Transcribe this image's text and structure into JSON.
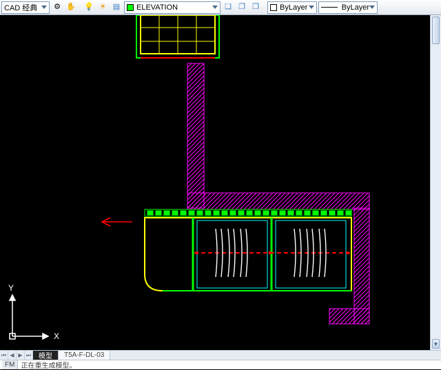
{
  "toolbar": {
    "workspace": "CAD 经典",
    "layer": "ELEVATION",
    "color_label": "ByLayer",
    "lineweight": "ByLayer",
    "layer_swatch": "#00ff00",
    "color_swatch": "#ffffff"
  },
  "tabs": {
    "nav": [
      "⏮",
      "◀",
      "▶",
      "⏭"
    ],
    "model": "模型",
    "layout1": "T5A-F-DL-03"
  },
  "command": {
    "prefix": "FM",
    "text": "正在重生成模型。"
  },
  "ucs": {
    "x": "X",
    "y": "Y"
  },
  "colors": {
    "magenta": "#ff00ff",
    "green": "#00ff00",
    "yellow": "#ffff00",
    "red": "#ff0000",
    "white": "#ffffff",
    "cyan": "#00ffff"
  }
}
